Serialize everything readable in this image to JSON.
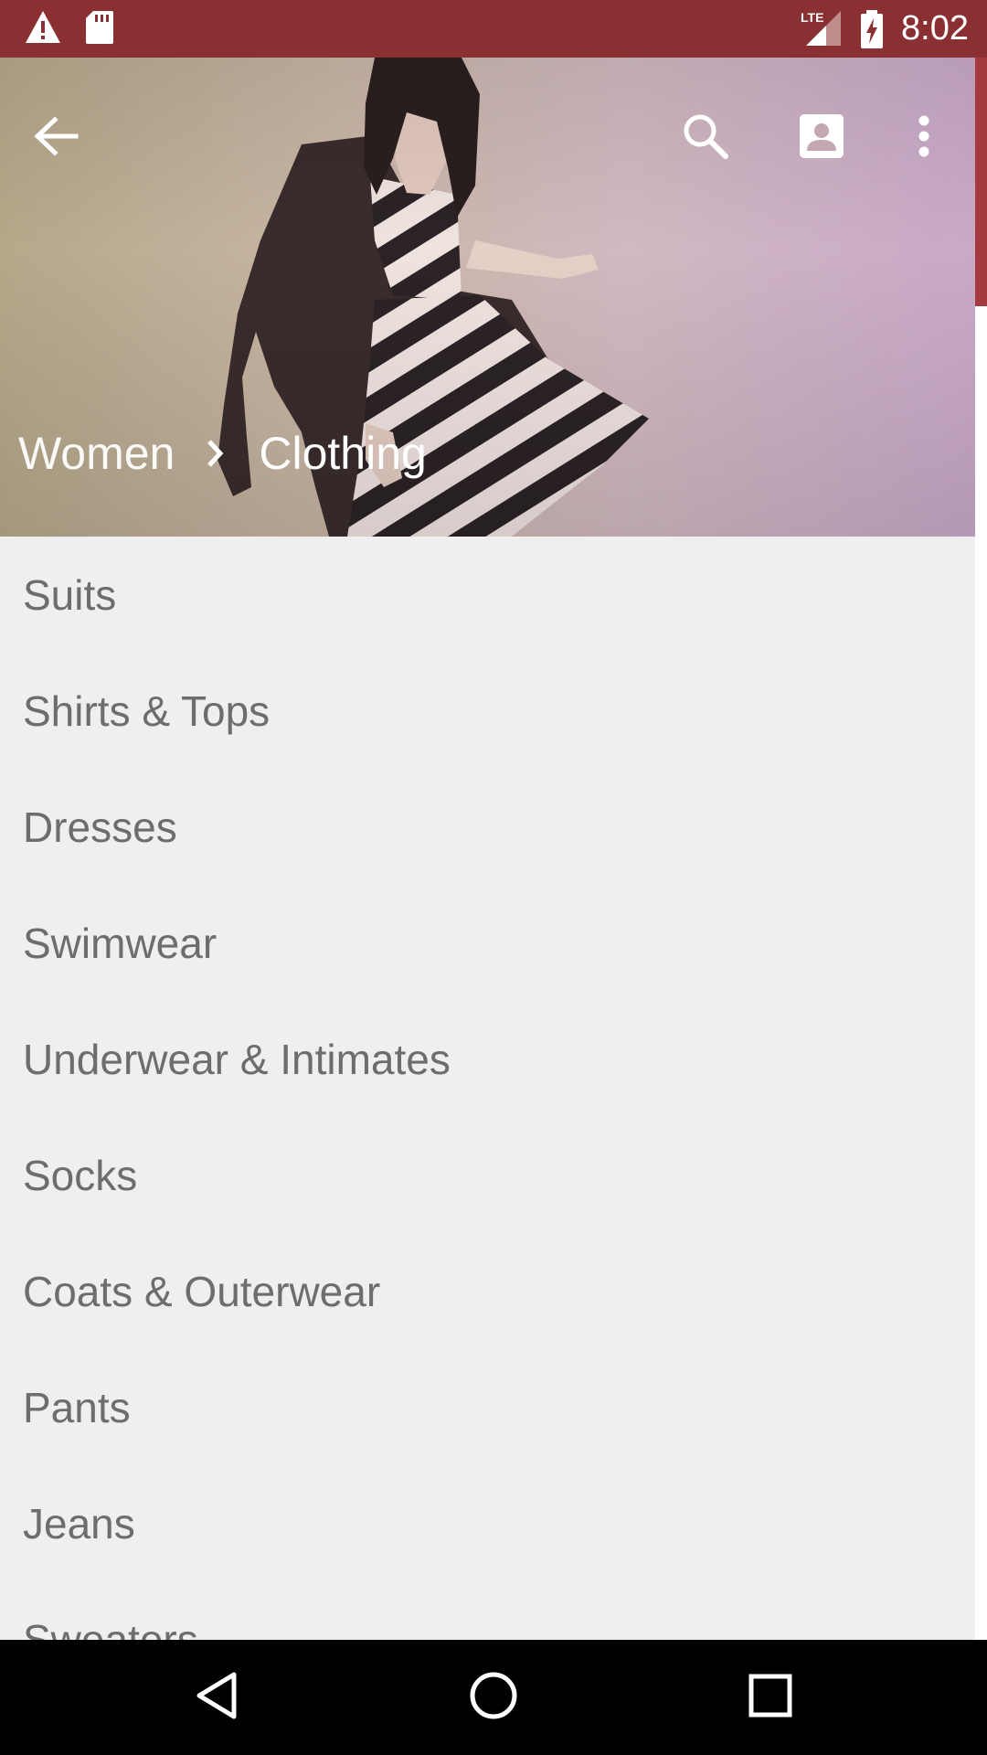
{
  "status_bar": {
    "time": "8:02",
    "network": "LTE",
    "icons": [
      "warning-icon",
      "sd-card-icon",
      "lte-signal-icon",
      "battery-charging-icon"
    ],
    "background_color": "#8b3032"
  },
  "toolbar": {
    "back_icon": "arrow-back-icon",
    "search_icon": "search-icon",
    "account_icon": "account-box-icon",
    "overflow_icon": "more-vert-icon"
  },
  "breadcrumb": {
    "parent": "Women",
    "separator_icon": "chevron-right-icon",
    "current": "Clothing"
  },
  "categories": [
    {
      "label": "Suits"
    },
    {
      "label": "Shirts & Tops"
    },
    {
      "label": "Dresses"
    },
    {
      "label": "Swimwear"
    },
    {
      "label": "Underwear & Intimates"
    },
    {
      "label": "Socks"
    },
    {
      "label": "Coats & Outerwear"
    },
    {
      "label": "Pants"
    },
    {
      "label": "Jeans"
    },
    {
      "label": "Sweaters"
    }
  ],
  "nav_bar": {
    "back_icon": "nav-back-icon",
    "home_icon": "nav-home-icon",
    "recents_icon": "nav-recents-icon"
  },
  "colors": {
    "accent": "#8b3032",
    "list_text": "#6d6d6f",
    "list_background": "#efeff0"
  }
}
